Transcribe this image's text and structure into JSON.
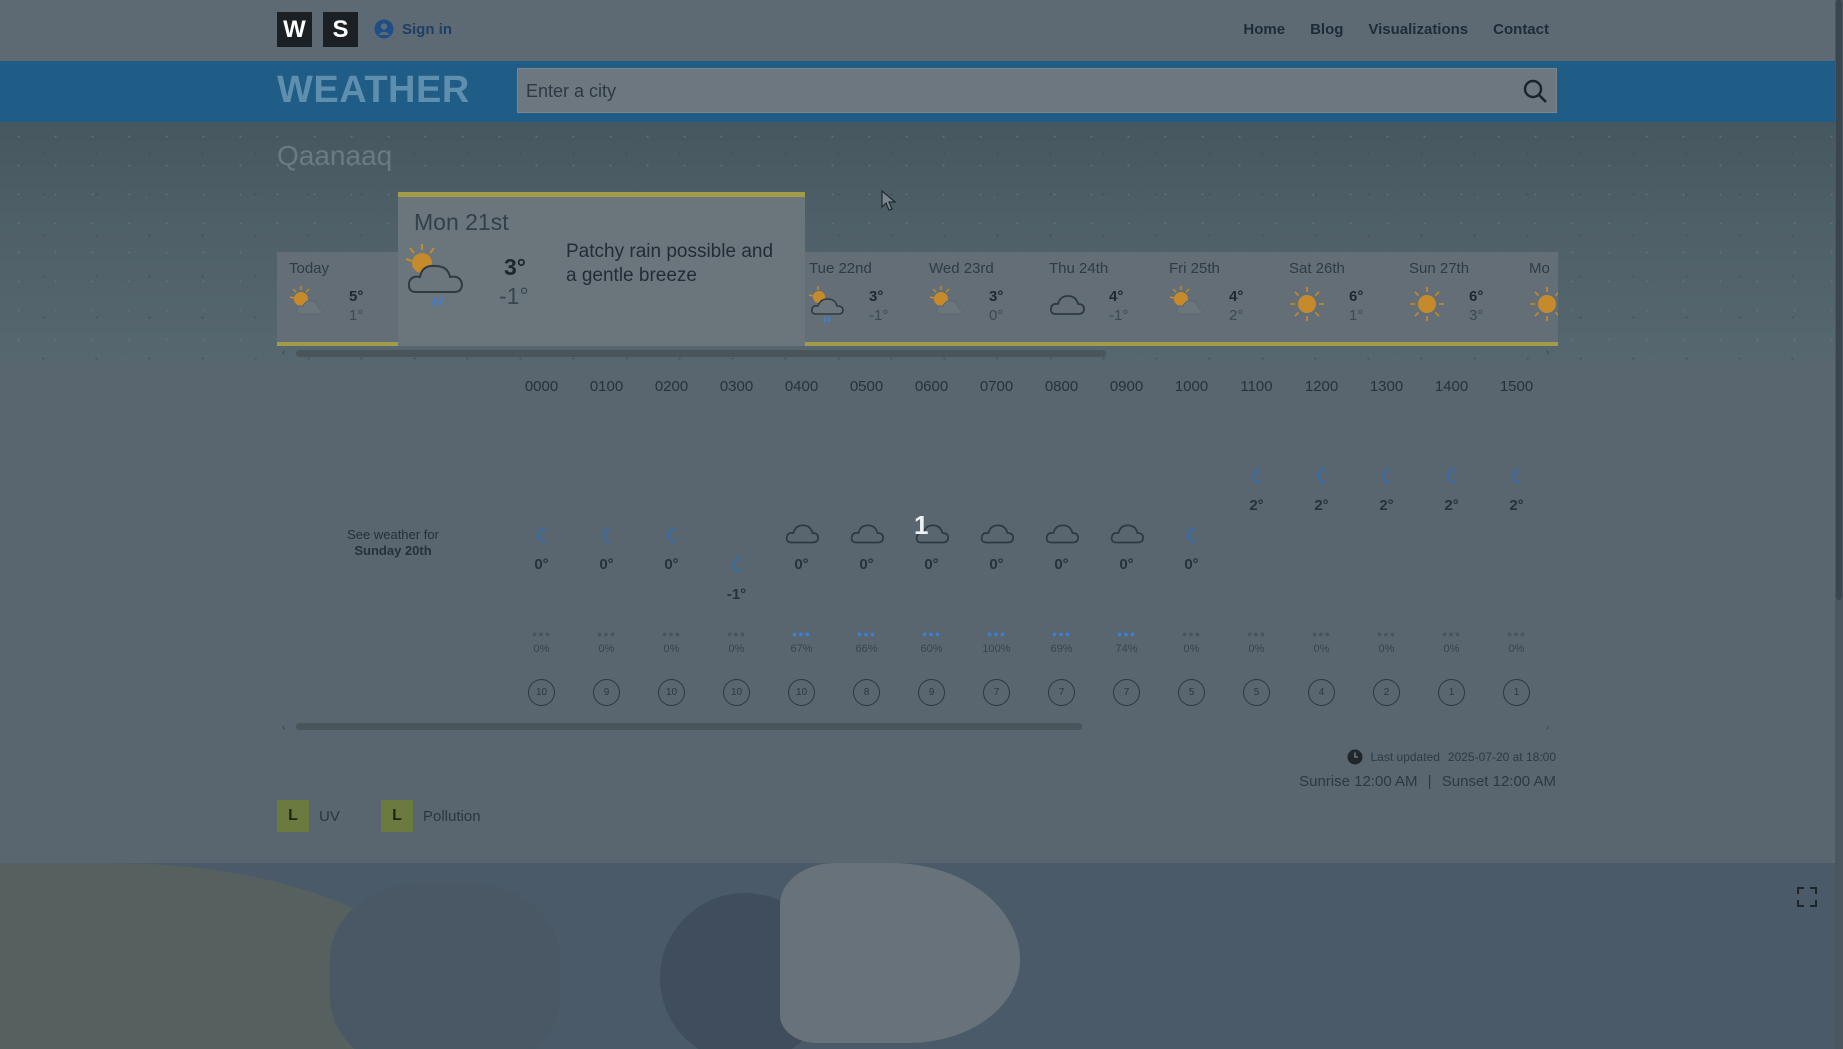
{
  "header": {
    "logo_letters": [
      "W",
      "S"
    ],
    "signin_label": "Sign in",
    "nav": [
      "Home",
      "Blog",
      "Visualizations",
      "Contact"
    ]
  },
  "banner": {
    "brand": "WEATHER",
    "search_placeholder": "Enter a city"
  },
  "location": {
    "city": "Qaanaaq"
  },
  "days": [
    {
      "name": "Today",
      "icon": "sun-cloud-icon",
      "hi": "5°",
      "lo": "1°"
    },
    {
      "name": "Tue 22nd",
      "icon": "rain-cloud-icon",
      "hi": "3°",
      "lo": "-1°"
    },
    {
      "name": "Wed 23rd",
      "icon": "sun-cloud-icon",
      "hi": "3°",
      "lo": "0°"
    },
    {
      "name": "Thu 24th",
      "icon": "cloud-icon",
      "hi": "4°",
      "lo": "-1°"
    },
    {
      "name": "Fri 25th",
      "icon": "sun-cloud-icon",
      "hi": "4°",
      "lo": "2°"
    },
    {
      "name": "Sat 26th",
      "icon": "sun-icon",
      "hi": "6°",
      "lo": "1°"
    },
    {
      "name": "Sun 27th",
      "icon": "sun-icon",
      "hi": "6°",
      "lo": "3°"
    },
    {
      "name": "Mo",
      "icon": "sun-icon",
      "hi": "",
      "lo": ""
    }
  ],
  "selected_day": {
    "name": "Mon 21st",
    "icon": "rain-cloud-icon",
    "hi": "3°",
    "lo": "-1°",
    "description": "Patchy rain possible and a gentle breeze"
  },
  "hourly": {
    "see_weather_prefix": "See weather for",
    "see_weather_day": "Sunday 20th",
    "overlay_number": "1",
    "hours": [
      {
        "time": "0000",
        "icon": "moon-icon",
        "temp": "0°",
        "rain": "0%",
        "rain_level": 0,
        "wind": "10"
      },
      {
        "time": "0100",
        "icon": "moon-icon",
        "temp": "0°",
        "rain": "0%",
        "rain_level": 0,
        "wind": "9"
      },
      {
        "time": "0200",
        "icon": "moon-icon",
        "temp": "0°",
        "rain": "0%",
        "rain_level": 0,
        "wind": "10"
      },
      {
        "time": "0300",
        "icon": "moon-icon",
        "temp": "-1°",
        "rain": "0%",
        "rain_level": 0,
        "wind": "10"
      },
      {
        "time": "0400",
        "icon": "cloud-icon",
        "temp": "0°",
        "rain": "67%",
        "rain_level": 3,
        "wind": "10"
      },
      {
        "time": "0500",
        "icon": "cloud-icon",
        "temp": "0°",
        "rain": "66%",
        "rain_level": 3,
        "wind": "8"
      },
      {
        "time": "0600",
        "icon": "cloud-icon",
        "temp": "0°",
        "rain": "60%",
        "rain_level": 3,
        "wind": "9"
      },
      {
        "time": "0700",
        "icon": "cloud-icon",
        "temp": "0°",
        "rain": "100%",
        "rain_level": 3,
        "wind": "7"
      },
      {
        "time": "0800",
        "icon": "cloud-icon",
        "temp": "0°",
        "rain": "69%",
        "rain_level": 3,
        "wind": "7"
      },
      {
        "time": "0900",
        "icon": "cloud-icon",
        "temp": "0°",
        "rain": "74%",
        "rain_level": 3,
        "wind": "7"
      },
      {
        "time": "1000",
        "icon": "moon-icon",
        "temp": "0°",
        "rain": "0%",
        "rain_level": 0,
        "wind": "5"
      },
      {
        "time": "1100",
        "icon": "moon-icon",
        "temp": "2°",
        "rain": "0%",
        "rain_level": 0,
        "wind": "5"
      },
      {
        "time": "1200",
        "icon": "moon-icon",
        "temp": "2°",
        "rain": "0%",
        "rain_level": 0,
        "wind": "4"
      },
      {
        "time": "1300",
        "icon": "moon-icon",
        "temp": "2°",
        "rain": "0%",
        "rain_level": 0,
        "wind": "2"
      },
      {
        "time": "1400",
        "icon": "moon-icon",
        "temp": "2°",
        "rain": "0%",
        "rain_level": 0,
        "wind": "1"
      },
      {
        "time": "1500",
        "icon": "moon-icon",
        "temp": "2°",
        "rain": "0%",
        "rain_level": 0,
        "wind": "1"
      }
    ]
  },
  "footer_info": {
    "last_updated_label": "Last updated",
    "last_updated_value": "2025-07-20 at 18:00",
    "sunrise": "Sunrise 12:00 AM",
    "separator": "|",
    "sunset": "Sunset 12:00 AM"
  },
  "badges": [
    {
      "letter": "L",
      "label": "UV"
    },
    {
      "letter": "L",
      "label": "Pollution"
    }
  ],
  "colors": {
    "accent": "#1f5c86",
    "day_underline": "#a29b49",
    "rain_dot": "#3d7fd1",
    "sun": "#c58a2b"
  }
}
